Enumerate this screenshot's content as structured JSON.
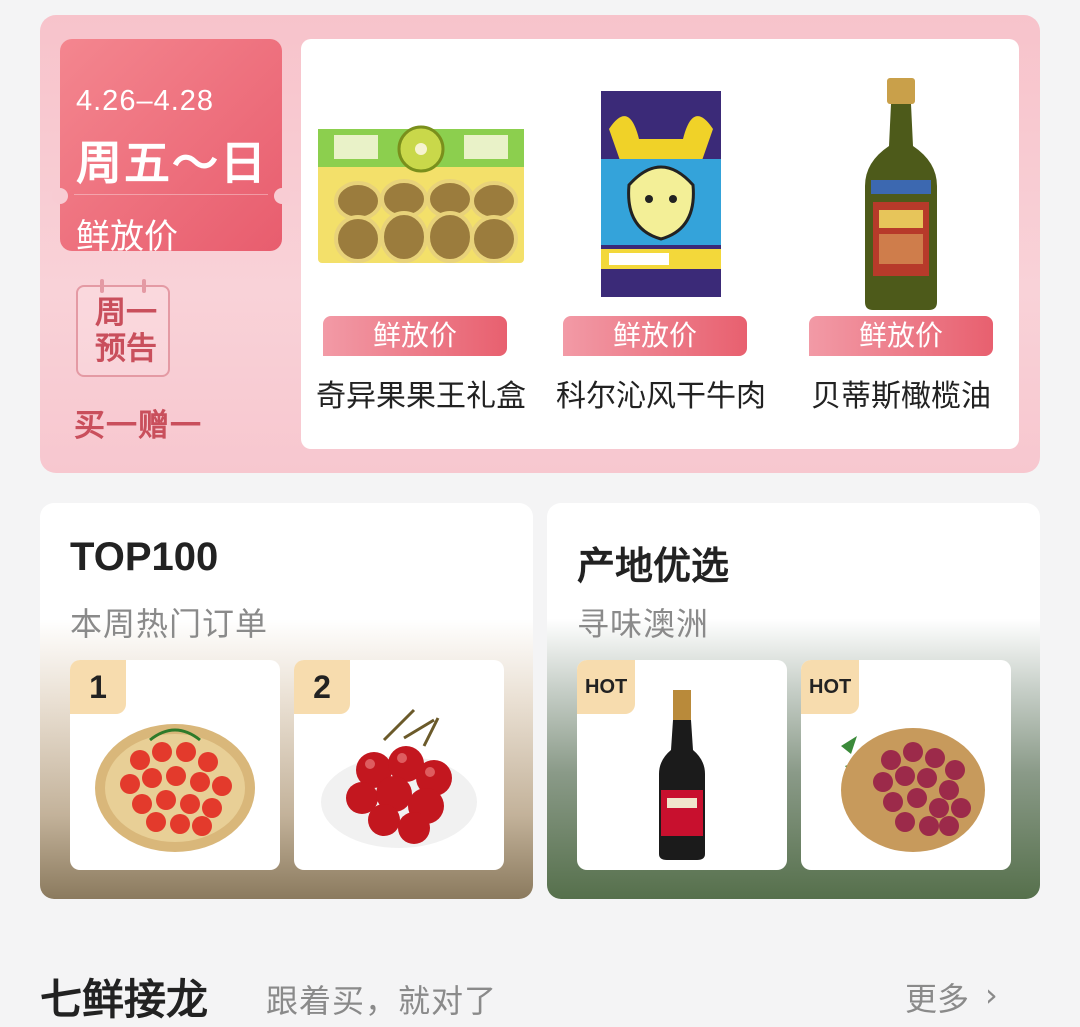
{
  "promo": {
    "date_range": "4.26–4.28",
    "day_range": "周五～日",
    "ticket_label": "鲜放价",
    "calendar_text_line1": "周一",
    "calendar_text_line2": "预告",
    "sub_promo": "买一赠一",
    "products": [
      {
        "tag": "鲜放价",
        "name": "奇异果果王礼盒",
        "icon": "kiwi-box-icon"
      },
      {
        "tag": "鲜放价",
        "name": "科尔沁风干牛肉",
        "icon": "beef-jerky-pack-icon"
      },
      {
        "tag": "鲜放价",
        "name": "贝蒂斯橄榄油",
        "icon": "olive-oil-bottle-icon"
      }
    ]
  },
  "top100": {
    "title": "TOP100",
    "subtitle": "本周热门订单",
    "tiles": [
      {
        "badge": "1",
        "icon": "cherry-tomato-basket-icon"
      },
      {
        "badge": "2",
        "icon": "cherries-plate-icon"
      }
    ]
  },
  "origin": {
    "title": "产地优选",
    "subtitle": "寻味澳洲",
    "tiles": [
      {
        "badge": "HOT",
        "icon": "sparkling-wine-bottle-icon"
      },
      {
        "badge": "HOT",
        "icon": "red-grapes-basket-icon"
      }
    ]
  },
  "section": {
    "title": "七鲜接龙",
    "subtitle": "跟着买，就对了",
    "more_label": "更多",
    "more_icon": "chevron-right-icon"
  },
  "colors": {
    "promo_bg": "#f8c9d1",
    "accent": "#e8606f",
    "badge": "#f7dcae"
  }
}
